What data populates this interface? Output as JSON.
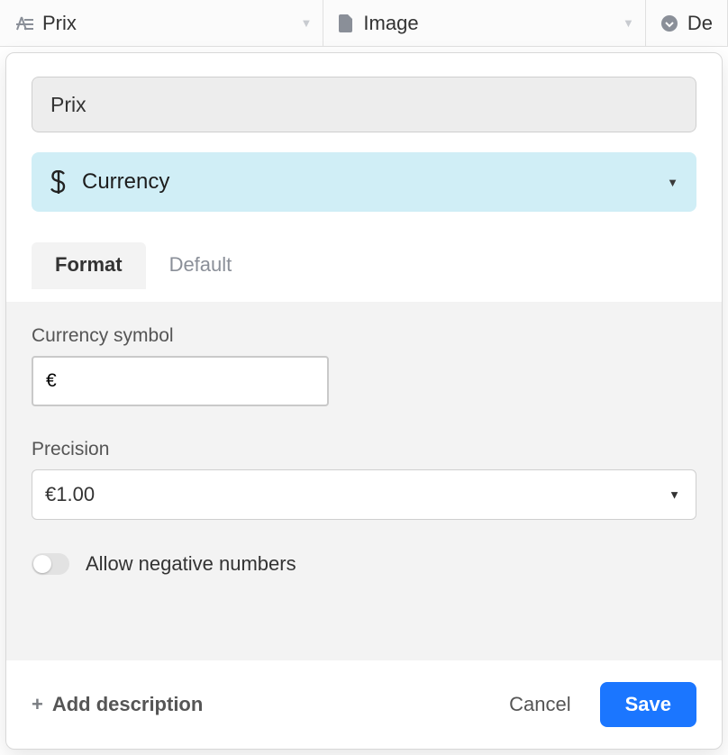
{
  "columns": {
    "prix": {
      "label": "Prix"
    },
    "image": {
      "label": "Image"
    },
    "de": {
      "label": "De"
    }
  },
  "fieldEditor": {
    "nameValue": "Prix",
    "type": {
      "icon": "currency-icon",
      "label": "Currency"
    },
    "tabs": {
      "format": "Format",
      "default": "Default",
      "active": "format"
    },
    "formatPane": {
      "currencySymbol": {
        "label": "Currency symbol",
        "value": "€"
      },
      "precision": {
        "label": "Precision",
        "value": "€1.00"
      },
      "allowNegative": {
        "label": "Allow negative numbers",
        "value": false
      }
    },
    "footer": {
      "addDescription": "Add description",
      "cancel": "Cancel",
      "save": "Save"
    }
  }
}
